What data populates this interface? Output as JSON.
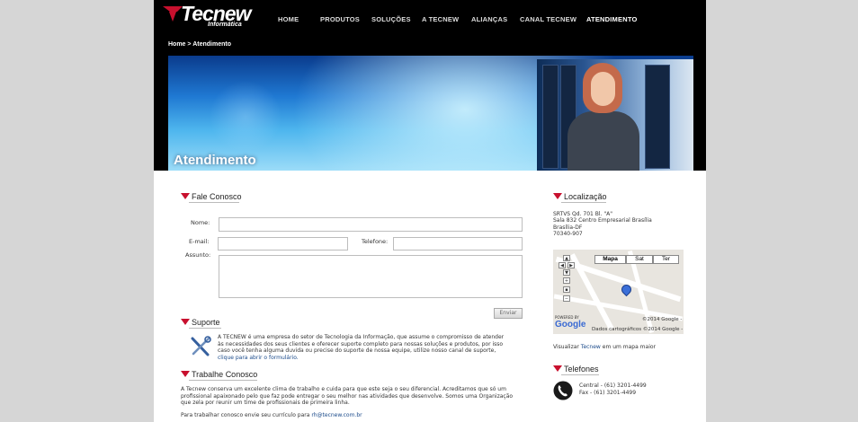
{
  "brand": {
    "name": "Tecnew",
    "tagline": "Informática"
  },
  "nav": [
    {
      "label": "HOME"
    },
    {
      "label": "PRODUTOS"
    },
    {
      "label": "SOLUÇÕES"
    },
    {
      "label": "A TECNEW"
    },
    {
      "label": "ALIANÇAS"
    },
    {
      "label": "CANAL TECNEW"
    },
    {
      "label": "ATENDIMENTO",
      "active": true
    }
  ],
  "breadcrumb": {
    "home": "Home",
    "separator": ">",
    "current": "Atendimento"
  },
  "banner": {
    "title": "Atendimento"
  },
  "contact_form": {
    "heading": "Fale Conosco",
    "name_label": "Nome:",
    "email_label": "E-mail:",
    "phone_label": "Telefone:",
    "subject_label": "Assunto:",
    "name_value": "",
    "email_value": "",
    "phone_value": "",
    "subject_value": "",
    "submit_label": "Enviar"
  },
  "support": {
    "heading": "Suporte",
    "text_1": "A TECNEW é uma empresa do setor de Tecnologia da Informação, que assume o compromisso de atender",
    "text_2": "às necessidades dos seus clientes e oferecer suporte completo para nossas soluções e produtos, por isso",
    "text_3": "caso você tenha alguma duvida ou precise do suporte de nossa equipe, utilize nosso canal de suporte,",
    "link": "clique para abrir o formulário."
  },
  "jobs": {
    "heading": "Trabalhe Conosco",
    "text_1": "A Tecnew conserva um excelente clima de trabalho e cuida para que este seja o seu diferencial. Acreditamos que só um",
    "text_2": "profissional apaixonado pelo que faz pode entregar o seu melhor nas atividades que desenvolve. Somos uma Organização",
    "text_3": "que zela por reunir um time de profissionais de primeira linha.",
    "cv_prefix": "Para trabalhar conosco envie seu currículo para",
    "cv_email": "rh@tecnew.com.br"
  },
  "location": {
    "heading": "Localização",
    "address_1": "SRTVS Qd. 701 Bl. \"A\"",
    "address_2": "Sala 832 Centro Empresarial Brasília",
    "address_3": "Brasília-DF",
    "address_4": "70340-907",
    "map": {
      "tabs": [
        "Mapa",
        "Sat",
        "Ter"
      ],
      "copyright": "©2014 Google -",
      "data_label": "Dados cartográficos ©2014 Google -",
      "powered_by": "POWERED BY",
      "google": "Google"
    },
    "view_prefix": "Visualizar",
    "view_brand": "Tecnew",
    "view_suffix": "em um mapa maior"
  },
  "phones": {
    "heading": "Telefones",
    "central": "Central - (61) 3201-4499",
    "fax": "Fax - (61) 3201-4499"
  },
  "colors": {
    "accent": "#c8102e",
    "link": "#1a4a8a",
    "side": "#d6d6d6"
  }
}
